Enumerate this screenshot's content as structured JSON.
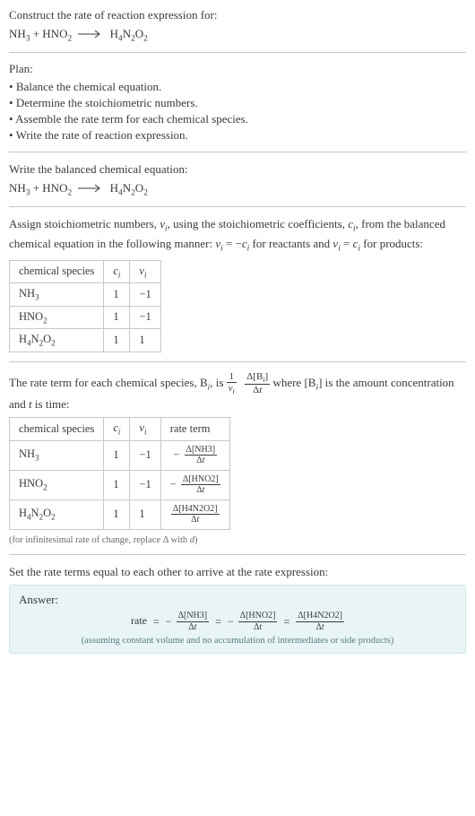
{
  "header": {
    "prompt": "Construct the rate of reaction expression for:"
  },
  "equation": {
    "r1": "NH",
    "r1s": "3",
    "r2a": "HNO",
    "r2s": "2",
    "p1a": "H",
    "p1s1": "4",
    "p1b": "N",
    "p1s2": "2",
    "p1c": "O",
    "p1s3": "2"
  },
  "plan": {
    "title": "Plan:",
    "items": [
      "Balance the chemical equation.",
      "Determine the stoichiometric numbers.",
      "Assemble the rate term for each chemical species.",
      "Write the rate of reaction expression."
    ]
  },
  "balanced": {
    "title": "Write the balanced chemical equation:"
  },
  "stoich": {
    "intro_a": "Assign stoichiometric numbers, ",
    "nu": "ν",
    "sub_i": "i",
    "intro_b": ", using the stoichiometric coefficients, ",
    "c": "c",
    "intro_c": ", from the balanced chemical equation in the following manner: ",
    "eq1a": "ν",
    "eq1b": " = −",
    "eq1c": "c",
    "intro_d": " for reactants and ",
    "eq2a": "ν",
    "eq2b": " = ",
    "eq2c": "c",
    "intro_e": " for products:"
  },
  "table1": {
    "headers": [
      "chemical species",
      "cᵢ",
      "νᵢ"
    ],
    "rows": [
      {
        "sp": "NH3",
        "c": "1",
        "v": "−1"
      },
      {
        "sp": "HNO2",
        "c": "1",
        "v": "−1"
      },
      {
        "sp": "H4N2O2",
        "c": "1",
        "v": "1"
      }
    ]
  },
  "rateterm": {
    "a": "The rate term for each chemical species, B",
    "b": ", is ",
    "c": " where [B",
    "d": "] is the amount concentration and ",
    "t": "t",
    "e": " is time:"
  },
  "frac_main": {
    "one": "1",
    "nu": "ν",
    "i": "i",
    "deltaB": "Δ[B",
    "close": "]",
    "dt": "Δt"
  },
  "table2": {
    "headers": [
      "chemical species",
      "cᵢ",
      "νᵢ",
      "rate term"
    ],
    "rows": [
      {
        "sp": "NH3",
        "c": "1",
        "v": "−1",
        "sign": "−",
        "conc": "Δ[NH3]",
        "dt": "Δt"
      },
      {
        "sp": "HNO2",
        "c": "1",
        "v": "−1",
        "sign": "−",
        "conc": "Δ[HNO2]",
        "dt": "Δt"
      },
      {
        "sp": "H4N2O2",
        "c": "1",
        "v": "1",
        "sign": "",
        "conc": "Δ[H4N2O2]",
        "dt": "Δt"
      }
    ],
    "note": "(for infinitesimal rate of change, replace Δ with d)"
  },
  "setequal": "Set the rate terms equal to each other to arrive at the rate expression:",
  "answer": {
    "label": "Answer:",
    "rate": "rate",
    "eq": "=",
    "neg": "−",
    "t1n": "Δ[NH3]",
    "t1d": "Δt",
    "t2n": "Δ[HNO2]",
    "t2d": "Δt",
    "t3n": "Δ[H4N2O2]",
    "t3d": "Δt",
    "note": "(assuming constant volume and no accumulation of intermediates or side products)"
  },
  "chart_data": {
    "type": "table",
    "tables": [
      {
        "title": "stoichiometric numbers",
        "columns": [
          "chemical species",
          "c_i",
          "nu_i"
        ],
        "rows": [
          [
            "NH3",
            1,
            -1
          ],
          [
            "HNO2",
            1,
            -1
          ],
          [
            "H4N2O2",
            1,
            1
          ]
        ]
      },
      {
        "title": "rate terms",
        "columns": [
          "chemical species",
          "c_i",
          "nu_i",
          "rate term"
        ],
        "rows": [
          [
            "NH3",
            1,
            -1,
            "-Δ[NH3]/Δt"
          ],
          [
            "HNO2",
            1,
            -1,
            "-Δ[HNO2]/Δt"
          ],
          [
            "H4N2O2",
            1,
            1,
            "Δ[H4N2O2]/Δt"
          ]
        ]
      }
    ],
    "rate_expression": "rate = -Δ[NH3]/Δt = -Δ[HNO2]/Δt = Δ[H4N2O2]/Δt"
  }
}
